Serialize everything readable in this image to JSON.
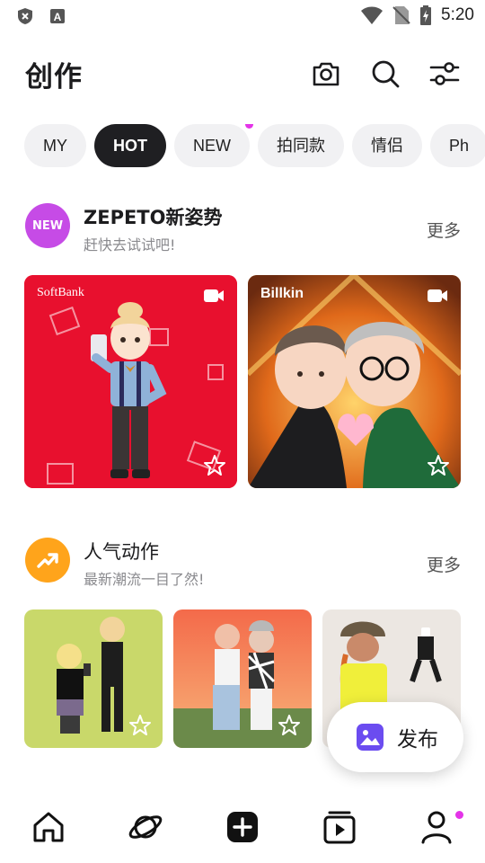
{
  "status_bar": {
    "time": "5:20"
  },
  "header": {
    "title": "创作"
  },
  "chips": [
    {
      "label": "MY",
      "active": false,
      "dot": false
    },
    {
      "label": "HOT",
      "active": true,
      "dot": false
    },
    {
      "label": "NEW",
      "active": false,
      "dot": true
    },
    {
      "label": "拍同款",
      "active": false,
      "dot": false
    },
    {
      "label": "情侣",
      "active": false,
      "dot": false
    },
    {
      "label": "Ph",
      "active": false,
      "dot": false
    }
  ],
  "sections": [
    {
      "badge_text": "NEW",
      "badge_color": "#c64be6",
      "title": "ZEPETO新姿势",
      "subtitle": "赶快去试试吧!",
      "more": "更多",
      "cards": [
        {
          "brand": "SoftBank",
          "bg": "#e8102e"
        },
        {
          "brand": "Billkin",
          "bg": "#f08a2a"
        }
      ]
    },
    {
      "badge_color": "#ffa41b",
      "title": "人气动作",
      "subtitle": "最新潮流一目了然!",
      "more": "更多",
      "cards": [
        {
          "bg": "#c9d86a"
        },
        {
          "bg": "#f0705a"
        },
        {
          "bg": "#ece7e2"
        }
      ]
    }
  ],
  "fab": {
    "label": "发布"
  },
  "colors": {
    "accent": "#e434e8",
    "fab_icon": "#6b4cf0"
  }
}
